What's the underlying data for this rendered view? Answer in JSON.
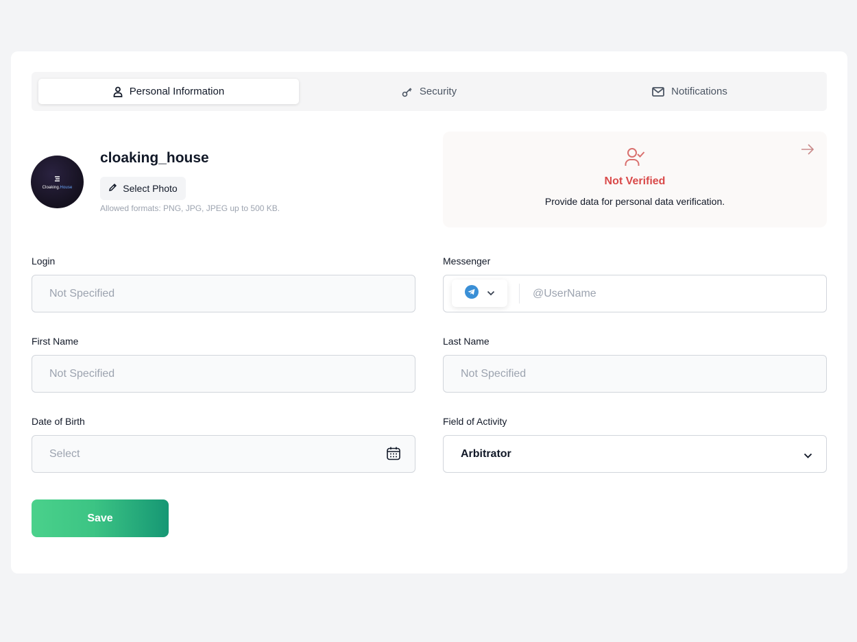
{
  "tabs": [
    {
      "label": "Personal Information",
      "icon": "user-icon",
      "active": true
    },
    {
      "label": "Security",
      "icon": "key-icon",
      "active": false
    },
    {
      "label": "Notifications",
      "icon": "mail-icon",
      "active": false
    }
  ],
  "profile": {
    "username": "cloaking_house",
    "avatar_text_left": "Cloaking.",
    "avatar_text_right": "House",
    "select_photo_label": "Select Photo",
    "formats_hint": "Allowed formats: PNG, JPG, JPEG up to 500 KB."
  },
  "verification": {
    "title": "Not Verified",
    "description": "Provide data for personal data verification.",
    "status_color": "#d94a4a"
  },
  "form": {
    "login": {
      "label": "Login",
      "placeholder": "Not Specified"
    },
    "messenger": {
      "label": "Messenger",
      "placeholder": "@UserName",
      "selected_icon": "telegram-icon"
    },
    "first_name": {
      "label": "First Name",
      "placeholder": "Not Specified"
    },
    "last_name": {
      "label": "Last Name",
      "placeholder": "Not Specified"
    },
    "date_of_birth": {
      "label": "Date of Birth",
      "placeholder": "Select"
    },
    "field_of_activity": {
      "label": "Field of Activity",
      "value": "Arbitrator"
    }
  },
  "actions": {
    "save_label": "Save"
  },
  "colors": {
    "accent_start": "#4ad18b",
    "accent_end": "#169774",
    "background": "#f3f4f6"
  }
}
